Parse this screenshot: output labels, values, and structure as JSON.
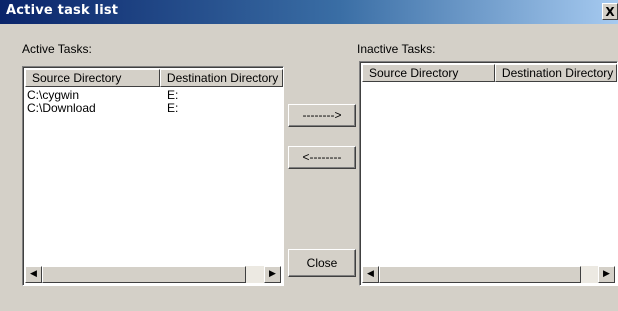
{
  "window": {
    "title": "Active task list",
    "close_glyph": "X"
  },
  "active": {
    "label": "Active Tasks:",
    "columns": [
      "Source Directory",
      "Destination Directory"
    ],
    "rows": [
      {
        "source": "C:\\cygwin",
        "destination": "E:"
      },
      {
        "source": "C:\\Download",
        "destination": "E:"
      }
    ]
  },
  "inactive": {
    "label": "Inactive Tasks:",
    "columns": [
      "Source Directory",
      "Destination Directory"
    ],
    "rows": []
  },
  "buttons": {
    "move_right": "-------->",
    "move_left": "<--------",
    "close": "Close"
  },
  "icons": {
    "scroll_left": "left-arrow-icon",
    "scroll_right": "right-arrow-icon",
    "window_close": "close-icon"
  }
}
